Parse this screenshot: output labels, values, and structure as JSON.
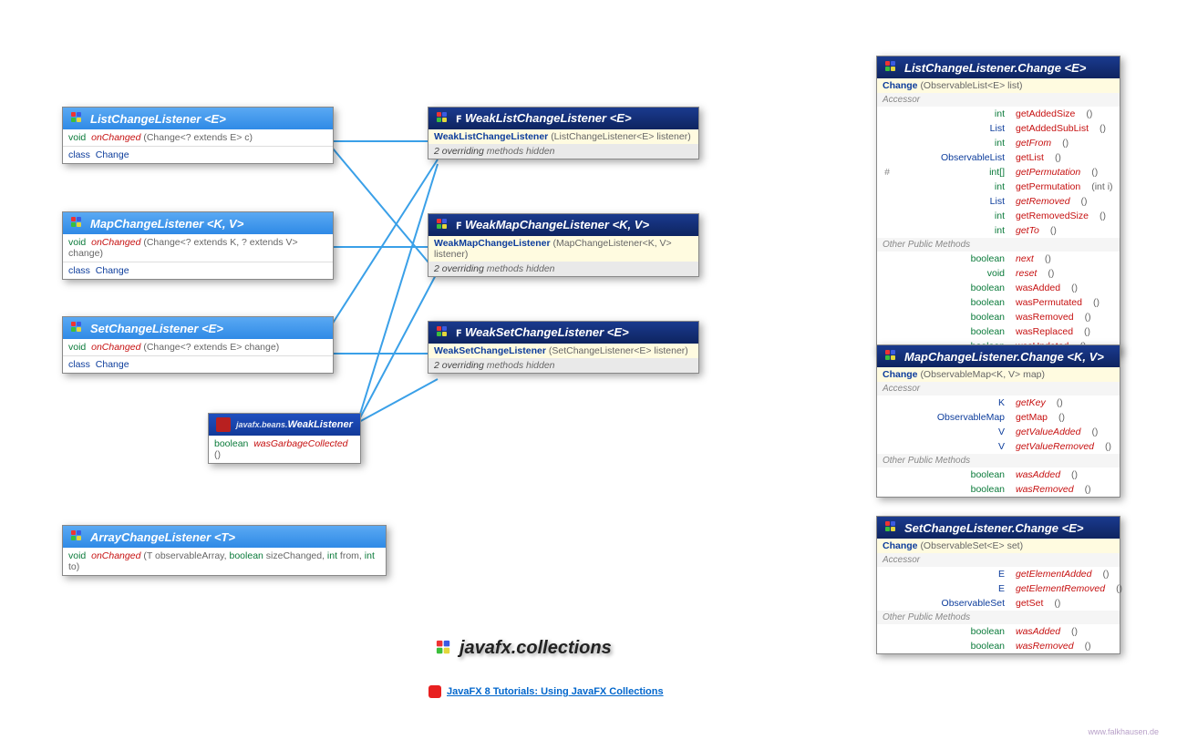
{
  "title": "javafx.collections",
  "footer_link": "JavaFX 8 Tutorials: Using JavaFX Collections",
  "watermark": "www.falkhausen.de",
  "classes": {
    "listChange": {
      "title": "ListChangeListener <E>",
      "row1": "void  onChanged (Change<? extends E> c)",
      "row2": "class  Change"
    },
    "mapChange": {
      "title": "MapChangeListener <K, V>",
      "row1": "void  onChanged (Change<? extends K, ? extends V> change)",
      "row2": "class  Change"
    },
    "setChange": {
      "title": "SetChangeListener <E>",
      "row1": "void  onChanged (Change<? extends E> change)",
      "row2": "class  Change"
    },
    "arrayChange": {
      "title": "ArrayChangeListener <T>",
      "row1": "void  onChanged (T observableArray, boolean sizeChanged, int from, int to)"
    },
    "weakList": {
      "title": "WeakListChangeListener <E>",
      "ctor": "WeakListChangeListener (ListChangeListener<E> listener)",
      "note": "2 overriding methods hidden"
    },
    "weakMap": {
      "title": "WeakMapChangeListener <K, V>",
      "ctor": "WeakMapChangeListener (MapChangeListener<K, V> listener)",
      "note": "2 overriding methods hidden"
    },
    "weakSet": {
      "title": "WeakSetChangeListener <E>",
      "ctor": "WeakSetChangeListener (SetChangeListener<E> listener)",
      "note": "2 overriding methods hidden"
    },
    "weakListener": {
      "pkg": "javafx.beans.",
      "title": "WeakListener",
      "row1": "boolean  wasGarbageCollected ()"
    },
    "lcc": {
      "title": "ListChangeListener.Change <E>",
      "ctor": "Change (ObservableList<E> list)",
      "accessor_label": "Accessor",
      "other_label": "Other Public Methods",
      "accessors": [
        {
          "ret": "int",
          "name": "getAddedSize",
          "p": "()"
        },
        {
          "ret": "List<E>",
          "name": "getAddedSubList",
          "p": "()"
        },
        {
          "ret": "int",
          "name": "getFrom",
          "p": "()",
          "abs": true
        },
        {
          "ret": "ObservableList<E>",
          "name": "getList",
          "p": "()"
        },
        {
          "ret": "int[]",
          "name": "getPermutation",
          "p": "()",
          "abs": true,
          "hash": true
        },
        {
          "ret": "int",
          "name": "getPermutation",
          "p": "(int i)"
        },
        {
          "ret": "List<E>",
          "name": "getRemoved",
          "p": "()",
          "abs": true
        },
        {
          "ret": "int",
          "name": "getRemovedSize",
          "p": "()"
        },
        {
          "ret": "int",
          "name": "getTo",
          "p": "()",
          "abs": true
        }
      ],
      "others": [
        {
          "ret": "boolean",
          "name": "next",
          "p": "()",
          "abs": true
        },
        {
          "ret": "void",
          "name": "reset",
          "p": "()",
          "abs": true
        },
        {
          "ret": "boolean",
          "name": "wasAdded",
          "p": "()"
        },
        {
          "ret": "boolean",
          "name": "wasPermutated",
          "p": "()"
        },
        {
          "ret": "boolean",
          "name": "wasRemoved",
          "p": "()"
        },
        {
          "ret": "boolean",
          "name": "wasReplaced",
          "p": "()"
        },
        {
          "ret": "boolean",
          "name": "wasUpdated",
          "p": "()"
        }
      ]
    },
    "mcc": {
      "title": "MapChangeListener.Change <K, V>",
      "ctor": "Change (ObservableMap<K, V> map)",
      "accessor_label": "Accessor",
      "other_label": "Other Public Methods",
      "accessors": [
        {
          "ret": "K",
          "name": "getKey",
          "p": "()",
          "abs": true
        },
        {
          "ret": "ObservableMap<K, V>",
          "name": "getMap",
          "p": "()"
        },
        {
          "ret": "V",
          "name": "getValueAdded",
          "p": "()",
          "abs": true
        },
        {
          "ret": "V",
          "name": "getValueRemoved",
          "p": "()",
          "abs": true
        }
      ],
      "others": [
        {
          "ret": "boolean",
          "name": "wasAdded",
          "p": "()",
          "abs": true
        },
        {
          "ret": "boolean",
          "name": "wasRemoved",
          "p": "()",
          "abs": true
        }
      ]
    },
    "scc": {
      "title": "SetChangeListener.Change <E>",
      "ctor": "Change (ObservableSet<E> set)",
      "accessor_label": "Accessor",
      "other_label": "Other Public Methods",
      "accessors": [
        {
          "ret": "E",
          "name": "getElementAdded",
          "p": "()",
          "abs": true
        },
        {
          "ret": "E",
          "name": "getElementRemoved",
          "p": "()",
          "abs": true
        },
        {
          "ret": "ObservableSet<E>",
          "name": "getSet",
          "p": "()"
        }
      ],
      "others": [
        {
          "ret": "boolean",
          "name": "wasAdded",
          "p": "()",
          "abs": true
        },
        {
          "ret": "boolean",
          "name": "wasRemoved",
          "p": "()",
          "abs": true
        }
      ]
    }
  }
}
